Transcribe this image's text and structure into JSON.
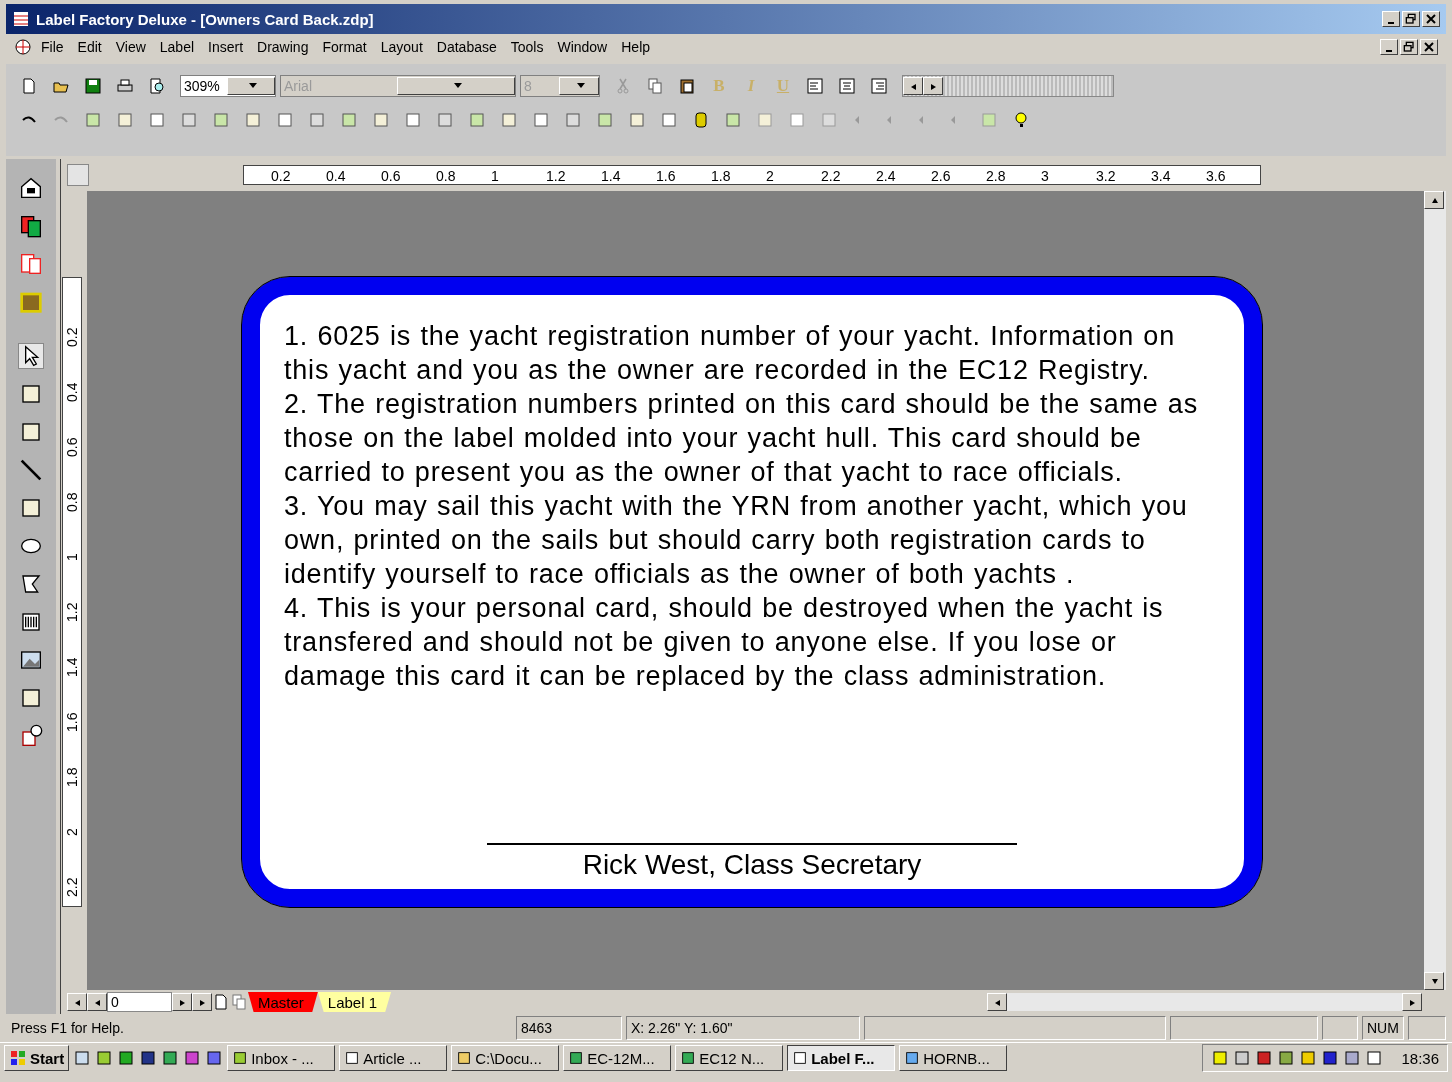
{
  "window": {
    "title": "Label Factory Deluxe - [Owners Card Back.zdp]"
  },
  "menu": [
    "File",
    "Edit",
    "View",
    "Label",
    "Insert",
    "Drawing",
    "Format",
    "Layout",
    "Database",
    "Tools",
    "Window",
    "Help"
  ],
  "toolbar": {
    "zoom": "309%",
    "font": "Arial",
    "font_size": "8",
    "format_buttons": [
      {
        "label": "B",
        "disabled": true
      },
      {
        "label": "I",
        "disabled": true
      },
      {
        "label": "U",
        "disabled": true
      }
    ]
  },
  "ruler_h": [
    "0.2",
    "0.4",
    "0.6",
    "0.8",
    "1",
    "1.2",
    "1.4",
    "1.6",
    "1.8",
    "2",
    "2.2",
    "2.4",
    "2.6",
    "2.8",
    "3",
    "3.2",
    "3.4",
    "3.6"
  ],
  "ruler_v": [
    "0.2",
    "0.4",
    "0.6",
    "0.8",
    "1",
    "1.2",
    "1.4",
    "1.6",
    "1.8",
    "2",
    "2.2"
  ],
  "card": {
    "paragraphs": [
      "1. 6025 is the yacht registration number of your yacht. Information on this yacht and you as the owner are recorded in the EC12 Registry.",
      "2. The registration numbers printed on this card should be the same as those on the label molded into your yacht hull. This card should be carried to present you as the owner of that yacht to race officials.",
      "3. You may sail this yacht with the YRN from another yacht, which you own, printed on the sails but should carry both registration cards to identify yourself to race officials as the owner of both yachts .",
      "4. This is your personal card, should be destroyed when the yacht is transfered and should not be given to anyone else. If you lose or damage this card it can be replaced by the class administration."
    ],
    "signature": "Rick West, Class Secretary"
  },
  "page_field": "0",
  "sheet_tabs": [
    {
      "label": "Master",
      "selected": true
    },
    {
      "label": "Label 1",
      "selected": false
    }
  ],
  "status_bar": {
    "help": "Press F1 for Help.",
    "count": "8463",
    "position": "X: 2.26\"   Y: 1.60\"",
    "num": "NUM"
  },
  "taskbar": {
    "start": "Start",
    "tasks": [
      {
        "label": "Inbox - ...",
        "selected": false
      },
      {
        "label": "Article ...",
        "selected": false
      },
      {
        "label": "C:\\Docu...",
        "selected": false
      },
      {
        "label": "EC-12M...",
        "selected": false
      },
      {
        "label": "EC12 N...",
        "selected": false
      },
      {
        "label": "Label F...",
        "selected": true
      },
      {
        "label": "HORNB...",
        "selected": false
      }
    ],
    "clock": "18:36"
  }
}
